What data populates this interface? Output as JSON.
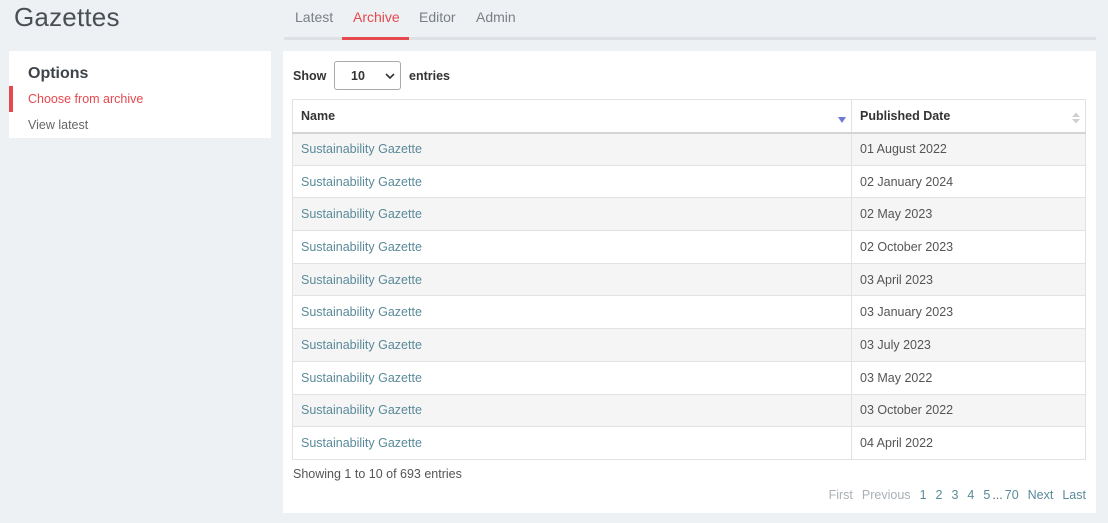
{
  "app": {
    "title": "Gazettes"
  },
  "nav": {
    "tabs": [
      {
        "label": "Latest"
      },
      {
        "label": "Archive"
      },
      {
        "label": "Editor"
      },
      {
        "label": "Admin"
      }
    ],
    "active_tab": "Archive"
  },
  "sidebar": {
    "title": "Options",
    "items": [
      {
        "label": "Choose from archive"
      },
      {
        "label": "View latest"
      }
    ]
  },
  "table_controls": {
    "show_label": "Show",
    "entries_label": "entries",
    "page_length": "10"
  },
  "table": {
    "columns": [
      "Name",
      "Published Date"
    ],
    "rows": [
      [
        "Sustainability Gazette",
        "01 August 2022"
      ],
      [
        "Sustainability Gazette",
        "02 January 2024"
      ],
      [
        "Sustainability Gazette",
        "02 May 2023"
      ],
      [
        "Sustainability Gazette",
        "02 October 2023"
      ],
      [
        "Sustainability Gazette",
        "03 April 2023"
      ],
      [
        "Sustainability Gazette",
        "03 January 2023"
      ],
      [
        "Sustainability Gazette",
        "03 July 2023"
      ],
      [
        "Sustainability Gazette",
        "03 May 2022"
      ],
      [
        "Sustainability Gazette",
        "03 October 2022"
      ],
      [
        "Sustainability Gazette",
        "04 April 2022"
      ]
    ]
  },
  "info": "Showing 1 to 10 of 693 entries",
  "pagination": {
    "first": "First",
    "previous": "Previous",
    "pages": [
      "1",
      "2",
      "3",
      "4",
      "5"
    ],
    "ellipsis": "...",
    "last_page": "70",
    "next": "Next",
    "last": "Last"
  },
  "colors": {
    "accent": "#e5484d",
    "link": "#5a8a9a",
    "sort_active": "#6b7bd6"
  }
}
